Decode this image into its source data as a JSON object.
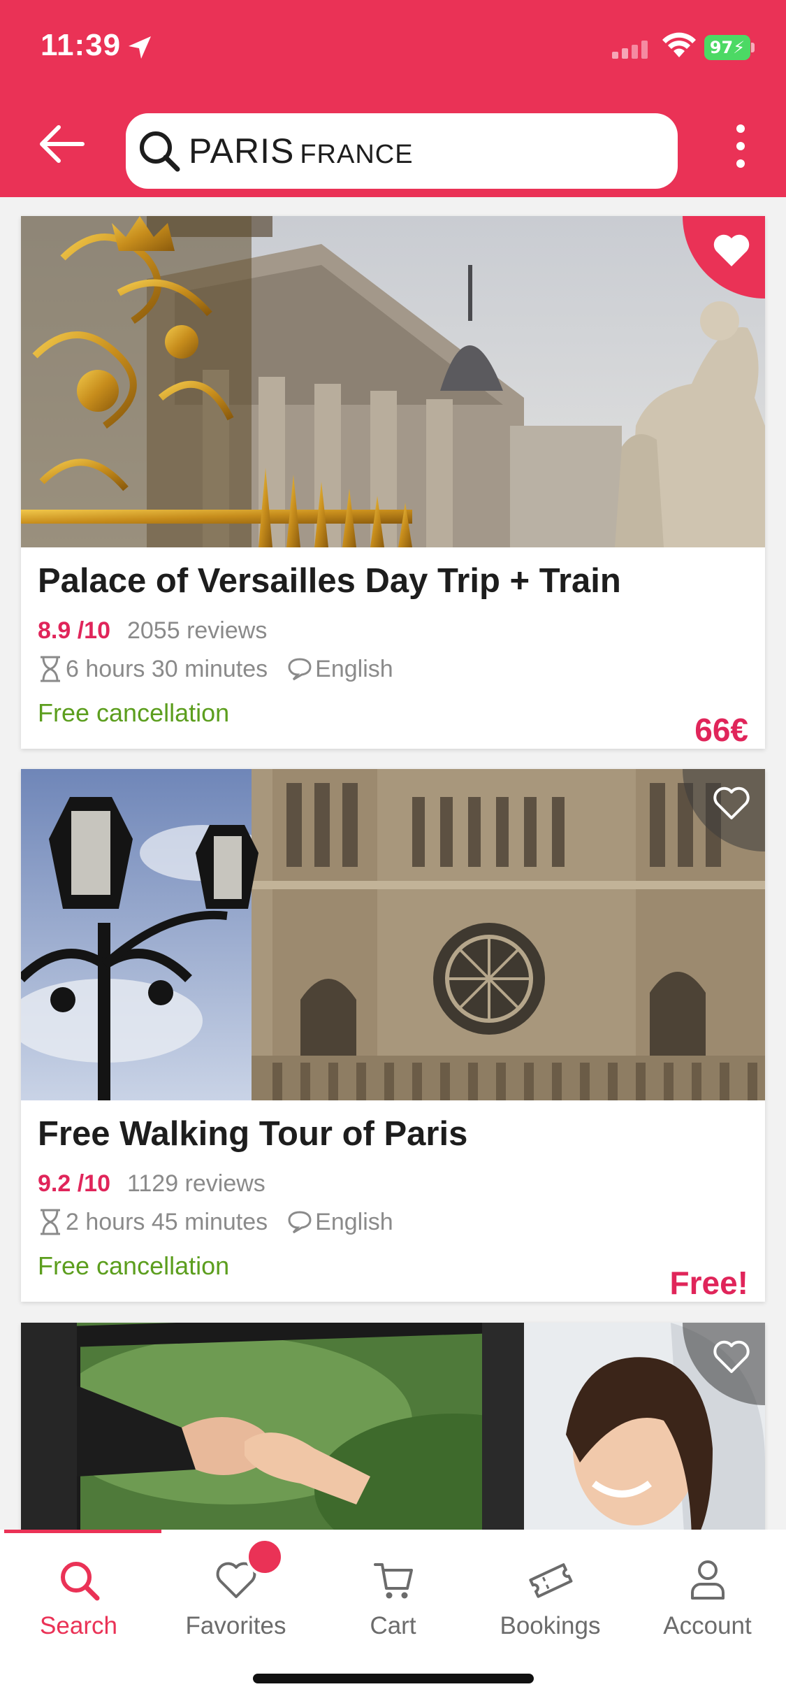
{
  "status_bar": {
    "time": "11:39",
    "battery": "97"
  },
  "header": {
    "search_city": "PARIS",
    "search_country": "FRANCE",
    "accent_color": "#ea3256"
  },
  "cards": [
    {
      "title": "Palace of Versailles Day Trip + Train",
      "score": "8.9 /10",
      "reviews": "2055 reviews",
      "duration": "6 hours 30 minutes",
      "language": "English",
      "cancellation": "Free cancellation",
      "price": "66€",
      "favorited": true
    },
    {
      "title": "Free Walking Tour of Paris",
      "score": "9.2 /10",
      "reviews": "1129 reviews",
      "duration": "2 hours 45 minutes",
      "language": "English",
      "cancellation": "Free cancellation",
      "price": "Free!",
      "favorited": false
    },
    {
      "favorited": false
    }
  ],
  "tabs": [
    {
      "label": "Search",
      "icon": "search-icon",
      "active": true
    },
    {
      "label": "Favorites",
      "icon": "heart-icon",
      "active": false
    },
    {
      "label": "Cart",
      "icon": "cart-icon",
      "active": false
    },
    {
      "label": "Bookings",
      "icon": "ticket-icon",
      "active": false
    },
    {
      "label": "Account",
      "icon": "person-icon",
      "active": false
    }
  ]
}
